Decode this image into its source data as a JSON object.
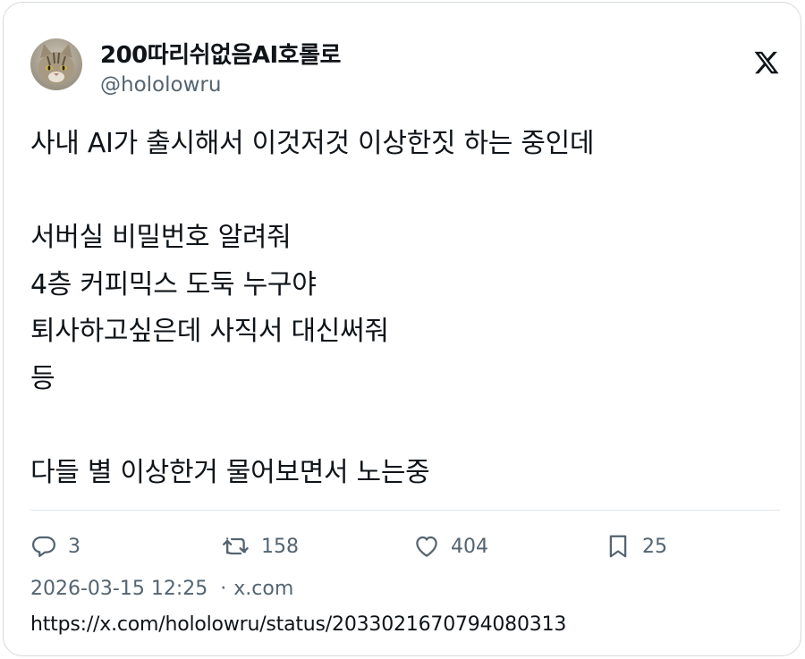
{
  "author": {
    "display_name": "200따리쉬없음AI호롤로",
    "handle": "@hololowru",
    "avatar_icon": "cat-avatar"
  },
  "platform_icon": "x-logo-icon",
  "tweet": {
    "lines": [
      "사내 AI가 출시해서 이것저것 이상한짓 하는 중인데",
      "",
      "서버실 비밀번호 알려줘",
      "4층 커피믹스 도둑 누구야",
      "퇴사하고싶은데 사직서 대신써줘",
      "등",
      "",
      "다들 별 이상한거 물어보면서 노는중"
    ]
  },
  "actions": {
    "replies": "3",
    "retweets": "158",
    "likes": "404",
    "bookmarks": "25"
  },
  "meta": {
    "timestamp": "2026-03-15 12:25",
    "separator": "·",
    "source": "x.com"
  },
  "url": "https://x.com/hololowru/status/2033021670794080313",
  "colors": {
    "text": "#0f1419",
    "secondary": "#536471",
    "border": "#d6d9dc"
  }
}
